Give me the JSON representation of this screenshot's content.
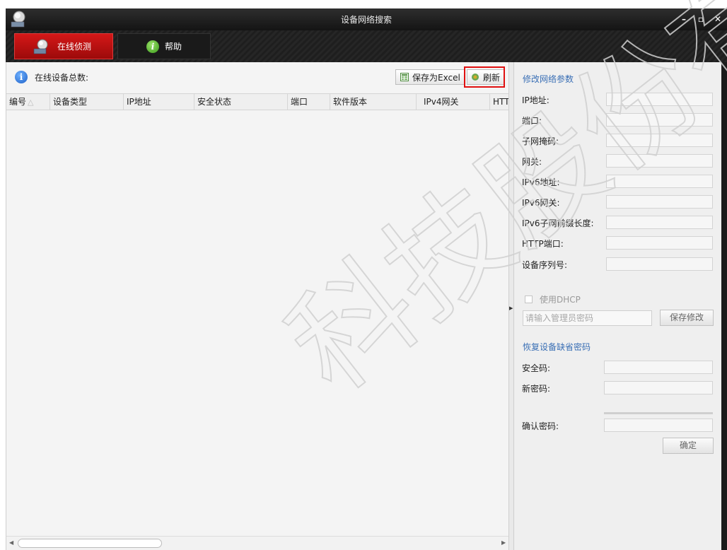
{
  "window": {
    "title": "设备网络搜索",
    "minimize": "–",
    "maximize": "▫",
    "close": "✕"
  },
  "tabs": [
    {
      "label": "在线侦测",
      "icon": "search-device-icon",
      "active": true
    },
    {
      "label": "帮助",
      "icon": "info-icon",
      "active": false
    }
  ],
  "toolbar": {
    "total_label": "在线设备总数:",
    "excel_label": "保存为Excel",
    "refresh_label": "刷新"
  },
  "table": {
    "columns": [
      "编号",
      "设备类型",
      "IP地址",
      "安全状态",
      "端口",
      "软件版本",
      "IPv4网关",
      "HTT"
    ],
    "sort_indicator": "△",
    "rows": []
  },
  "network_params": {
    "title": "修改网络参数",
    "fields": [
      {
        "label": "IP地址:",
        "value": ""
      },
      {
        "label": "端口:",
        "value": ""
      },
      {
        "label": "子网掩码:",
        "value": ""
      },
      {
        "label": "网关:",
        "value": ""
      },
      {
        "label": "IPv6地址:",
        "value": ""
      },
      {
        "label": "IPv6网关:",
        "value": ""
      },
      {
        "label": "IPv6子网前缀长度:",
        "value": ""
      },
      {
        "label": "HTTP端口:",
        "value": ""
      },
      {
        "label": "设备序列号:",
        "value": ""
      }
    ],
    "dhcp_label": "使用DHCP",
    "dhcp_checked": false,
    "admin_pwd_placeholder": "请输入管理员密码",
    "save_label": "保存修改"
  },
  "restore": {
    "title": "恢复设备缺省密码",
    "security_code_label": "安全码:",
    "new_pwd_label": "新密码:",
    "confirm_pwd_label": "确认密码:",
    "confirm_btn": "确定"
  },
  "watermark": {
    "text": "科技股份有限公司"
  },
  "colors": {
    "accent_red": "#c01010",
    "section_blue": "#3a6fb5",
    "highlight_red": "#e01010"
  }
}
